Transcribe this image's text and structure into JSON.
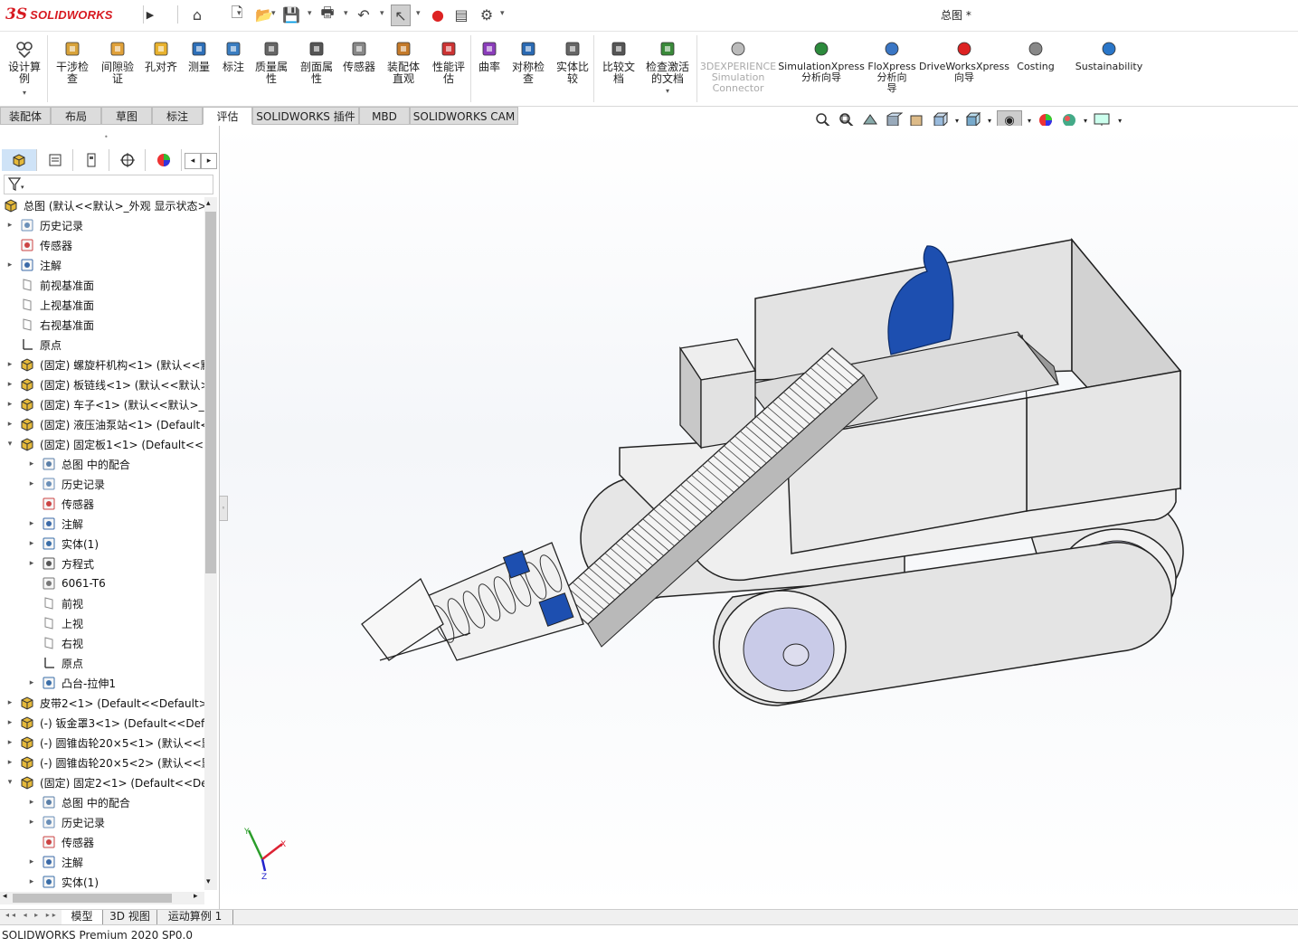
{
  "app": {
    "title": "总图 *",
    "brand_ds": "3S",
    "brand_name": "SOLIDWORKS"
  },
  "colors": {
    "brand": "#d71920",
    "tab_bg": "#dcdcdc",
    "accent": "#1a4aa8",
    "model_blue": "#1d4fb0"
  },
  "quick_access": [
    {
      "name": "home-icon",
      "glyph": "⌂"
    },
    {
      "name": "new-document-icon",
      "glyph": "🗋"
    },
    {
      "name": "open-folder-icon",
      "glyph": "📂"
    },
    {
      "name": "save-icon",
      "glyph": "💾"
    },
    {
      "name": "print-icon",
      "glyph": "🖶"
    },
    {
      "name": "undo-icon",
      "glyph": "↶"
    },
    {
      "name": "select-arrow-icon",
      "glyph": "↖"
    },
    {
      "name": "traffic-light-icon",
      "glyph": "●"
    },
    {
      "name": "file-properties-icon",
      "glyph": "▤"
    },
    {
      "name": "options-gear-icon",
      "glyph": "⚙"
    }
  ],
  "ribbon": {
    "design_study": "设计算\n例",
    "tools": [
      {
        "label": "干涉检\n查",
        "icon": "interference-check-icon"
      },
      {
        "label": "间隙验\n证",
        "icon": "clearance-verification-icon"
      },
      {
        "label": "孔对齐",
        "icon": "hole-alignment-icon"
      },
      {
        "label": "测量",
        "icon": "measure-icon"
      },
      {
        "label": "标注",
        "icon": "markup-icon"
      },
      {
        "label": "质量属\n性",
        "icon": "mass-properties-icon"
      },
      {
        "label": "剖面属\n性",
        "icon": "section-properties-icon"
      },
      {
        "label": "传感器",
        "icon": "sensor-icon"
      },
      {
        "label": "装配体\n直观",
        "icon": "assembly-visualization-icon"
      },
      {
        "label": "性能评\n估",
        "icon": "performance-evaluation-icon"
      },
      {
        "label": "曲率",
        "icon": "curvature-icon"
      },
      {
        "label": "对称检\n查",
        "icon": "symmetry-check-icon"
      },
      {
        "label": "实体比\n较",
        "icon": "body-compare-icon"
      },
      {
        "label": "比较文\n档",
        "icon": "compare-documents-icon"
      },
      {
        "label": "检查激活\n的文档",
        "icon": "check-active-document-icon"
      }
    ],
    "addins": [
      {
        "label": "3DEXPERIENCE\nSimulation\nConnector",
        "icon": "3dexperience-icon",
        "disabled": true
      },
      {
        "label": "SimulationXpress\n分析向导",
        "icon": "simulationxpress-icon"
      },
      {
        "label": "FloXpress\n分析向\n导",
        "icon": "floxpress-icon"
      },
      {
        "label": "DriveWorksXpress\n向导",
        "icon": "driveworksxpress-icon"
      },
      {
        "label": "Costing",
        "icon": "costing-icon"
      },
      {
        "label": "Sustainability",
        "icon": "sustainability-icon"
      }
    ]
  },
  "tabs": [
    "装配体",
    "布局",
    "草图",
    "标注",
    "评估",
    "SOLIDWORKS 插件",
    "MBD",
    "SOLIDWORKS CAM"
  ],
  "active_tab": "评估",
  "tree": {
    "root": "总图  (默认<<默认>_外观 显示状态>",
    "items": [
      {
        "label": "历史记录",
        "level": 1,
        "exp": "▸",
        "icon": "history-icon"
      },
      {
        "label": "传感器",
        "level": 1,
        "exp": "",
        "icon": "sensor-icon"
      },
      {
        "label": "注解",
        "level": 1,
        "exp": "▸",
        "icon": "annotations-icon"
      },
      {
        "label": "前视基准面",
        "level": 1,
        "exp": "",
        "icon": "plane-icon"
      },
      {
        "label": "上视基准面",
        "level": 1,
        "exp": "",
        "icon": "plane-icon"
      },
      {
        "label": "右视基准面",
        "level": 1,
        "exp": "",
        "icon": "plane-icon"
      },
      {
        "label": "原点",
        "level": 1,
        "exp": "",
        "icon": "origin-icon"
      },
      {
        "label": "(固定) 螺旋杆机构<1> (默认<<默",
        "level": 1,
        "exp": "▸",
        "icon": "subassembly-icon"
      },
      {
        "label": "(固定) 板链线<1> (默认<<默认>",
        "level": 1,
        "exp": "▸",
        "icon": "subassembly-icon"
      },
      {
        "label": "(固定) 车子<1> (默认<<默认>_",
        "level": 1,
        "exp": "▸",
        "icon": "subassembly-icon"
      },
      {
        "label": "(固定) 液压油泵站<1> (Default<",
        "level": 1,
        "exp": "▸",
        "icon": "part-icon"
      },
      {
        "label": "(固定) 固定板1<1> (Default<<D",
        "level": 1,
        "exp": "▾",
        "icon": "part-icon"
      },
      {
        "label": "总图 中的配合",
        "level": 2,
        "exp": "▸",
        "icon": "mates-icon"
      },
      {
        "label": "历史记录",
        "level": 2,
        "exp": "▸",
        "icon": "history-icon"
      },
      {
        "label": "传感器",
        "level": 2,
        "exp": "",
        "icon": "sensor-icon"
      },
      {
        "label": "注解",
        "level": 2,
        "exp": "▸",
        "icon": "annotations-icon"
      },
      {
        "label": "实体(1)",
        "level": 2,
        "exp": "▸",
        "icon": "solid-bodies-icon"
      },
      {
        "label": "方程式",
        "level": 2,
        "exp": "▸",
        "icon": "equations-icon"
      },
      {
        "label": "6061-T6",
        "level": 2,
        "exp": "",
        "icon": "material-icon"
      },
      {
        "label": "前视",
        "level": 2,
        "exp": "",
        "icon": "plane-icon"
      },
      {
        "label": "上视",
        "level": 2,
        "exp": "",
        "icon": "plane-icon"
      },
      {
        "label": "右视",
        "level": 2,
        "exp": "",
        "icon": "plane-icon"
      },
      {
        "label": "原点",
        "level": 2,
        "exp": "",
        "icon": "origin-icon"
      },
      {
        "label": "凸台-拉伸1",
        "level": 2,
        "exp": "▸",
        "icon": "boss-extrude-icon"
      },
      {
        "label": "皮带2<1> (Default<<Default>_",
        "level": 1,
        "exp": "▸",
        "icon": "part-icon"
      },
      {
        "label": "(-) 钣金罩3<1> (Default<<Defa",
        "level": 1,
        "exp": "▸",
        "icon": "part-icon"
      },
      {
        "label": "(-) 圆锥齿轮20×5<1> (默认<<默",
        "level": 1,
        "exp": "▸",
        "icon": "part-icon"
      },
      {
        "label": "(-) 圆锥齿轮20×5<2> (默认<<默",
        "level": 1,
        "exp": "▸",
        "icon": "part-icon"
      },
      {
        "label": "(固定) 固定2<1> (Default<<De",
        "level": 1,
        "exp": "▾",
        "icon": "part-icon"
      },
      {
        "label": "总图 中的配合",
        "level": 2,
        "exp": "▸",
        "icon": "mates-icon"
      },
      {
        "label": "历史记录",
        "level": 2,
        "exp": "▸",
        "icon": "history-icon"
      },
      {
        "label": "传感器",
        "level": 2,
        "exp": "",
        "icon": "sensor-icon"
      },
      {
        "label": "注解",
        "level": 2,
        "exp": "▸",
        "icon": "annotations-icon"
      },
      {
        "label": "实体(1)",
        "level": 2,
        "exp": "▸",
        "icon": "solid-bodies-icon"
      }
    ]
  },
  "bottom_tabs": [
    "模型",
    "3D 视图",
    "运动算例 1"
  ],
  "triad": {
    "x": "X",
    "y": "Y",
    "z": "Z"
  },
  "status": "SOLIDWORKS Premium 2020 SP0.0"
}
